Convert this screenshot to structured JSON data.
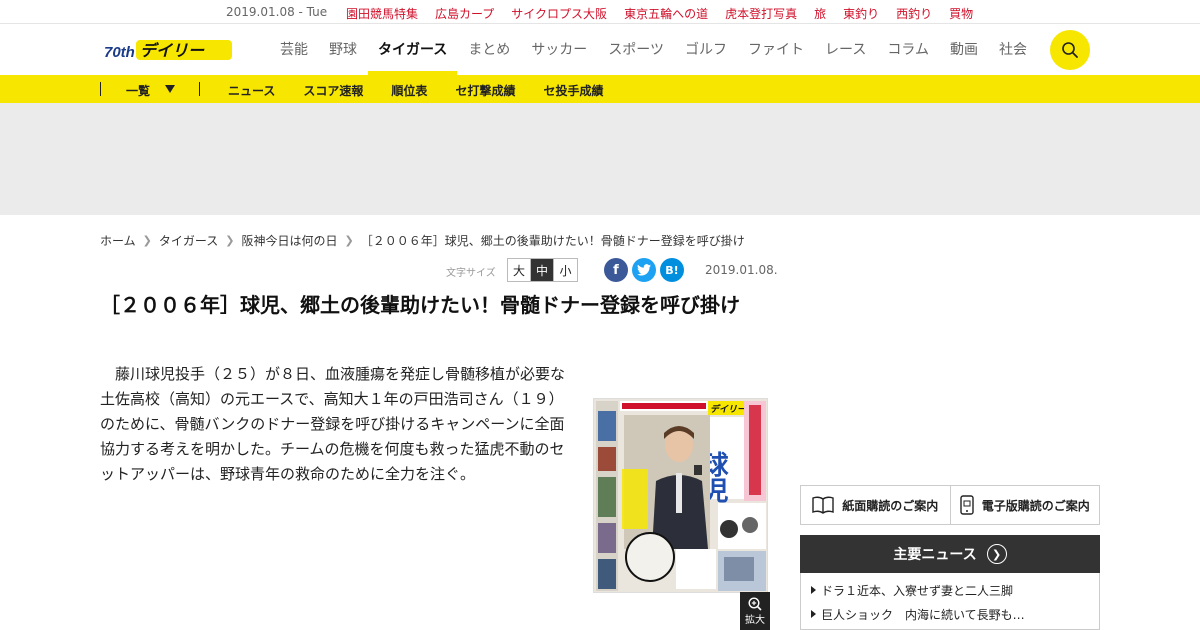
{
  "topbar": {
    "date": "2019.01.08 - Tue",
    "links": [
      "園田競馬特集",
      "広島カープ",
      "サイクロプス大阪",
      "東京五輪への道",
      "虎本登打写真",
      "旅",
      "東釣り",
      "西釣り",
      "買物"
    ]
  },
  "logo": {
    "text": "デイリー",
    "badge": "70th"
  },
  "nav": {
    "items": [
      "芸能",
      "野球",
      "タイガース",
      "まとめ",
      "サッカー",
      "スポーツ",
      "ゴルフ",
      "ファイト",
      "レース",
      "コラム",
      "動画",
      "社会"
    ],
    "active": "タイガース"
  },
  "subnav": {
    "dropdown": "一覧",
    "links": [
      "ニュース",
      "スコア速報",
      "順位表",
      "セ打撃成績",
      "セ投手成績"
    ]
  },
  "breadcrumb": [
    "ホーム",
    "タイガース",
    "阪神今日は何の日",
    "［２００６年］球児、郷土の後輩助けたい！骨髄ドナー登録を呼び掛け"
  ],
  "article": {
    "font_size_label": "文字サイズ",
    "font_sizes": [
      "大",
      "中",
      "小"
    ],
    "selected_font_size": "中",
    "date": "2019.01.08.",
    "headline": "［２００６年］球児、郷土の後輩助けたい！骨髄ドナー登録を呼び掛け",
    "body": "藤川球児投手（２５）が８日、血液腫瘍を発症し骨髄移植が必要な土佐高校（高知）の元エースで、高知大１年の戸田浩司さん（１９）のために、骨髄バンクのドナー登録を呼び掛けるキャンペーンに全面協力する考えを明かした。チームの危機を何度も救った猛虎不動のセットアッパーは、野球青年の救命のために全力を注ぐ。",
    "zoom_label": "拡大",
    "paper_masthead": "デイリー",
    "paper_headline": "球児",
    "share": {
      "facebook": "f",
      "twitter": "t",
      "hatena": "B!"
    }
  },
  "sidebar": {
    "subscribe_print": "紙面購読のご案内",
    "subscribe_digital": "電子版購読のご案内",
    "main_news_title": "主要ニュース",
    "main_news": [
      "ドラ１近本、入寮せず妻と二人三脚",
      "巨人ショック　内海に続いて長野も…"
    ]
  },
  "colors": {
    "brand_yellow": "#f6e600",
    "link_red": "#d0112b",
    "dark": "#333333",
    "facebook": "#3b5998",
    "twitter": "#1da1f2",
    "hatena": "#008fde"
  }
}
